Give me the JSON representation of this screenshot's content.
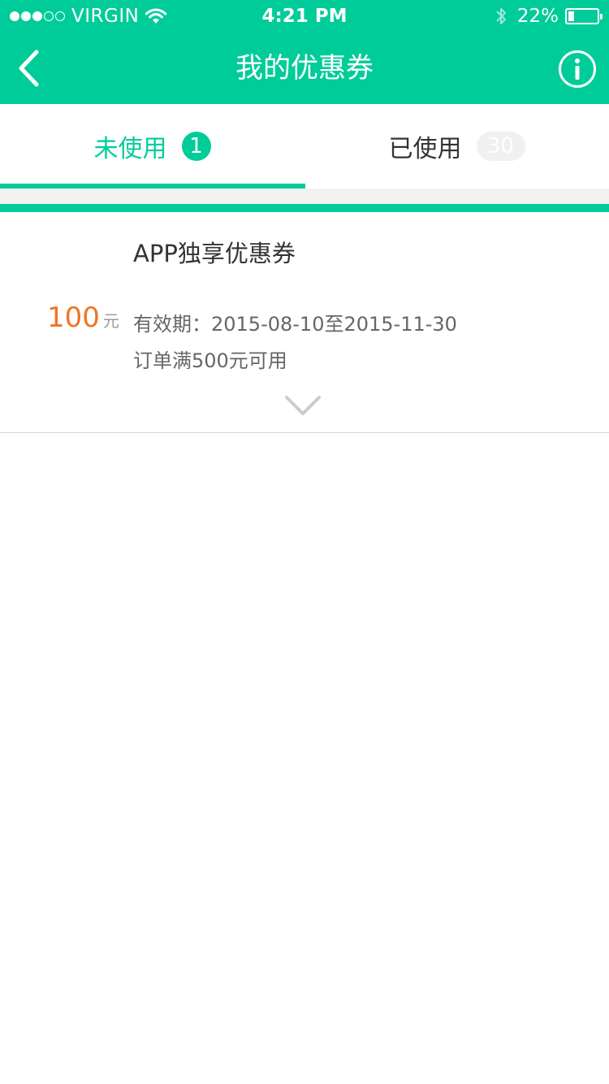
{
  "status_bar": {
    "carrier": "VIRGIN",
    "time": "4:21 PM",
    "battery_percent_text": "22%",
    "battery_level": 0.22,
    "signal_strength": 3,
    "signal_max": 5
  },
  "nav": {
    "title": "我的优惠券",
    "back_icon": "chevron-left-icon",
    "info_icon": "info-icon"
  },
  "tabs": [
    {
      "label": "未使用",
      "count": "1",
      "active": true
    },
    {
      "label": "已使用",
      "count": "30",
      "active": false
    }
  ],
  "coupon": {
    "title": "APP独享优惠券",
    "amount": "100",
    "unit": "元",
    "validity": "有效期：2015-08-10至2015-11-30",
    "condition": "订单满500元可用",
    "expand_icon": "chevron-down-icon"
  },
  "colors": {
    "accent": "#00cc99",
    "amount": "#f07424",
    "text_primary": "#333333",
    "text_secondary": "#666666"
  }
}
